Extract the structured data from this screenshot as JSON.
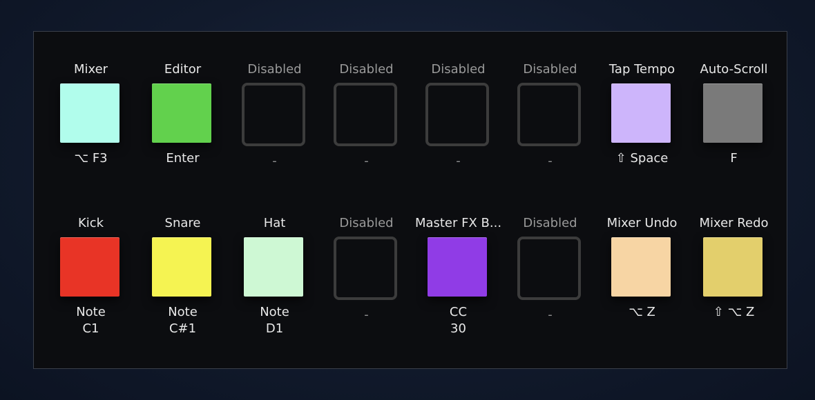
{
  "rows": [
    [
      {
        "title": "Mixer",
        "color": "#b1fdec",
        "sub1": "⌥ F3",
        "sub2": ""
      },
      {
        "title": "Editor",
        "color": "#62d14d",
        "sub1": "Enter",
        "sub2": ""
      },
      {
        "title": "Disabled",
        "color": "",
        "sub1": "-",
        "sub2": ""
      },
      {
        "title": "Disabled",
        "color": "",
        "sub1": "-",
        "sub2": ""
      },
      {
        "title": "Disabled",
        "color": "",
        "sub1": "-",
        "sub2": ""
      },
      {
        "title": "Disabled",
        "color": "",
        "sub1": "-",
        "sub2": ""
      },
      {
        "title": "Tap Tempo",
        "color": "#cdb5fb",
        "sub1": "⇧ Space",
        "sub2": ""
      },
      {
        "title": "Auto-Scroll",
        "color": "#7a7a7a",
        "sub1": "F",
        "sub2": ""
      }
    ],
    [
      {
        "title": "Kick",
        "color": "#e83426",
        "sub1": "Note",
        "sub2": "C1"
      },
      {
        "title": "Snare",
        "color": "#f5f352",
        "sub1": "Note",
        "sub2": "C#1"
      },
      {
        "title": "Hat",
        "color": "#cef8d4",
        "sub1": "Note",
        "sub2": "D1"
      },
      {
        "title": "Disabled",
        "color": "",
        "sub1": "-",
        "sub2": ""
      },
      {
        "title": "Master FX B...",
        "color": "#903ce6",
        "sub1": "CC",
        "sub2": "30"
      },
      {
        "title": "Disabled",
        "color": "",
        "sub1": "-",
        "sub2": ""
      },
      {
        "title": "Mixer Undo",
        "color": "#f7d5a4",
        "sub1": "⌥ Z",
        "sub2": ""
      },
      {
        "title": "Mixer Redo",
        "color": "#e3cf6c",
        "sub1": "⇧ ⌥ Z",
        "sub2": ""
      }
    ]
  ]
}
